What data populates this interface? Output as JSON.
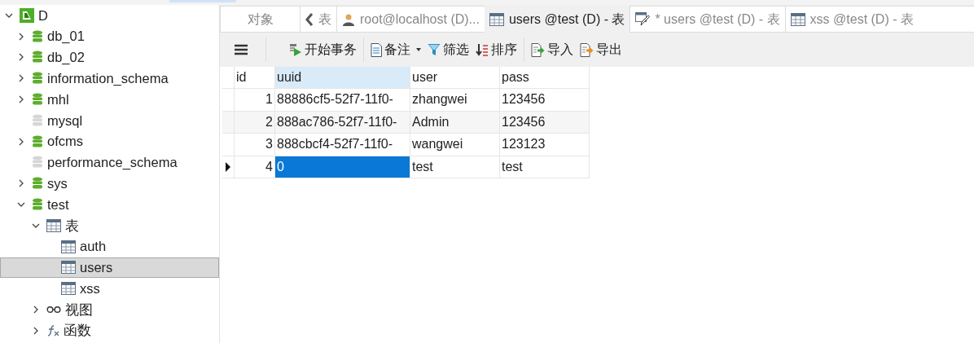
{
  "tree": [
    {
      "label": "D",
      "kind": "connection",
      "expanded": true,
      "selected": false,
      "children": [
        {
          "label": "db_01",
          "kind": "database",
          "expanded": false,
          "selected": false
        },
        {
          "label": "db_02",
          "kind": "database",
          "expanded": false,
          "selected": false
        },
        {
          "label": "information_schema",
          "kind": "database",
          "expanded": false,
          "selected": false
        },
        {
          "label": "mhl",
          "kind": "database",
          "expanded": false,
          "selected": false
        },
        {
          "label": "mysql",
          "kind": "closed_database",
          "selected": false
        },
        {
          "label": "ofcms",
          "kind": "database",
          "expanded": false,
          "selected": false
        },
        {
          "label": "performance_schema",
          "kind": "closed_database",
          "selected": false
        },
        {
          "label": "sys",
          "kind": "database",
          "expanded": false,
          "selected": false
        },
        {
          "label": "test",
          "kind": "database",
          "expanded": true,
          "selected": false,
          "children": [
            {
              "label": "表",
              "kind": "table",
              "expanded": true,
              "selected": false,
              "children": [
                {
                  "label": "auth",
                  "kind": "table",
                  "selected": false
                },
                {
                  "label": "users",
                  "kind": "table",
                  "selected": true
                },
                {
                  "label": "xss",
                  "kind": "table",
                  "selected": false
                }
              ]
            },
            {
              "label": "视图",
              "kind": "view",
              "expanded": false,
              "selected": false
            },
            {
              "label": "函数",
              "kind": "function",
              "expanded": false,
              "selected": false
            }
          ]
        }
      ]
    }
  ],
  "tabs": [
    {
      "label": "对象",
      "kind": "plain",
      "selected": false
    },
    {
      "label": "表",
      "kind": "back",
      "selected": false
    },
    {
      "label": "root@localhost (D)...",
      "kind": "user",
      "selected": false
    },
    {
      "label": "users @test (D) - 表",
      "kind": "table",
      "selected": true
    },
    {
      "label": "* users @test (D) - 表",
      "kind": "design",
      "selected": false
    },
    {
      "label": "xss @test (D) - 表",
      "kind": "table",
      "selected": false
    }
  ],
  "toolbar_groups": [
    [
      {
        "label": "开始事务",
        "kind": "transaction",
        "dropdown": false
      }
    ],
    [
      {
        "label": "备注",
        "kind": "note",
        "dropdown": true
      },
      {
        "label": "筛选",
        "kind": "filter",
        "dropdown": false
      },
      {
        "label": "排序",
        "kind": "sort",
        "dropdown": false
      }
    ],
    [
      {
        "label": "导入",
        "kind": "import",
        "dropdown": false
      },
      {
        "label": "导出",
        "kind": "export",
        "dropdown": false
      }
    ]
  ],
  "grid": {
    "columns": [
      {
        "label": "id",
        "selected": false
      },
      {
        "label": "uuid",
        "selected": true
      },
      {
        "label": "user",
        "selected": false
      },
      {
        "label": "pass",
        "selected": false
      }
    ],
    "rows": [
      {
        "current": false,
        "cells": [
          {
            "text": "1",
            "selected": false
          },
          {
            "text": "88886cf5-52f7-11f0-",
            "selected": false
          },
          {
            "text": "zhangwei",
            "selected": false
          },
          {
            "text": "123456",
            "selected": false
          }
        ]
      },
      {
        "current": false,
        "cells": [
          {
            "text": "2",
            "selected": false
          },
          {
            "text": "888ac786-52f7-11f0-",
            "selected": false
          },
          {
            "text": "Admin",
            "selected": false
          },
          {
            "text": "123456",
            "selected": false
          }
        ]
      },
      {
        "current": false,
        "cells": [
          {
            "text": "3",
            "selected": false
          },
          {
            "text": "888cbcf4-52f7-11f0-",
            "selected": false
          },
          {
            "text": "wangwei",
            "selected": false
          },
          {
            "text": "123123",
            "selected": false
          }
        ]
      },
      {
        "current": true,
        "cells": [
          {
            "text": "4",
            "selected": false
          },
          {
            "text": "0",
            "selected": true
          },
          {
            "text": "test",
            "selected": false
          },
          {
            "text": "test",
            "selected": false
          }
        ]
      }
    ]
  }
}
